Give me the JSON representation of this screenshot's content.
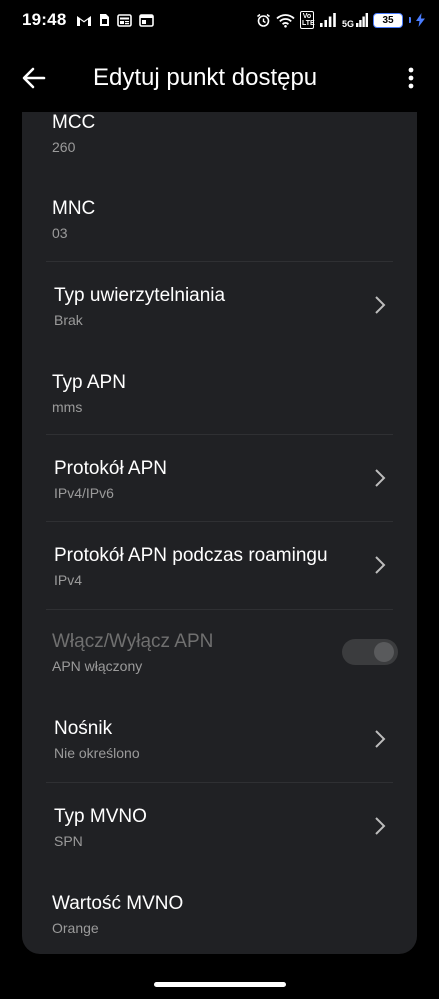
{
  "status_bar": {
    "time": "19:48",
    "left_icons": [
      "gmail-icon",
      "sim-card-icon",
      "news-icon",
      "browser-icon"
    ],
    "volte": "Vo LTE",
    "network": "5G",
    "battery": "35",
    "battery_color": "#4a7dff"
  },
  "app_bar": {
    "title": "Edytuj punkt dostępu"
  },
  "settings": {
    "mcc": {
      "title": "MCC",
      "value": "260"
    },
    "mnc": {
      "title": "MNC",
      "value": "03"
    },
    "auth_type": {
      "title": "Typ uwierzytelniania",
      "value": "Brak"
    },
    "apn_type": {
      "title": "Typ APN",
      "value": "mms"
    },
    "apn_protocol": {
      "title": "Protokół APN",
      "value": "IPv4/IPv6"
    },
    "apn_roaming_protocol": {
      "title": "Protokół APN podczas roamingu",
      "value": "IPv4"
    },
    "apn_enable": {
      "title": "Włącz/Wyłącz APN",
      "value": "APN włączony"
    },
    "bearer": {
      "title": "Nośnik",
      "value": "Nie określono"
    },
    "mvno_type": {
      "title": "Typ MVNO",
      "value": "SPN"
    },
    "mvno_value": {
      "title": "Wartość MVNO",
      "value": "Orange"
    }
  }
}
